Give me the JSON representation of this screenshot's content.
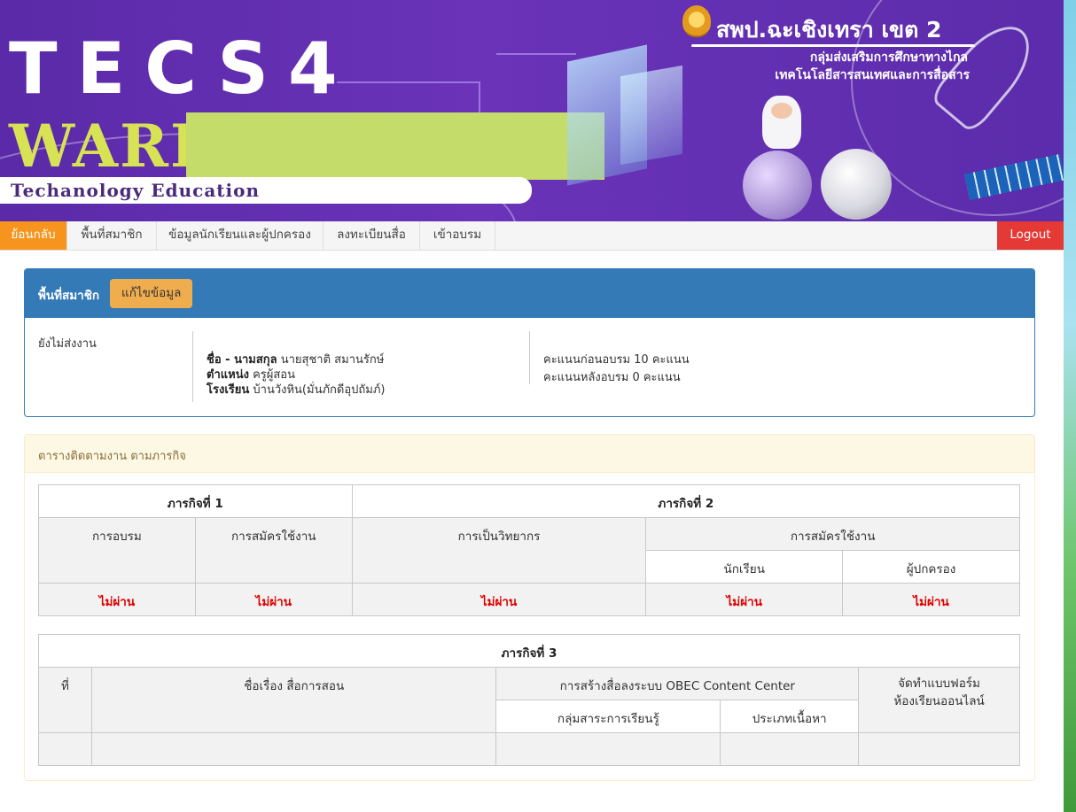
{
  "banner": {
    "logo_line1": "TECS4",
    "logo_line2": "WARR",
    "tagline": "Techanology Education",
    "agency": "สพป.ฉะเชิงเทรา เขต 2",
    "agency_sub1": "กลุ่มส่งเสริมการศึกษาทางไกล",
    "agency_sub2": "เทคโนโลยีสารสนเทศและการสื่อสาร"
  },
  "nav": {
    "back": "ย้อนกลับ",
    "items": [
      "พื้นที่สมาชิก",
      "ข้อมูลนักเรียนและผู้ปกครอง",
      "ลงทะเบียนสื่อ",
      "เข้าอบรม"
    ],
    "logout": "Logout"
  },
  "member": {
    "title": "พื้นที่สมาชิก",
    "edit_button": "แก้ไขข้อมูล",
    "status": "ยังไม่ส่งงาน",
    "name_label": "ชื่อ - นามสกุล",
    "name_value": "นายสุชาติ สมานรักษ์",
    "position_label": "ตำแหน่ง",
    "position_value": "ครูผู้สอน",
    "school_label": "โรงเรียน",
    "school_value": "บ้านวังหิน(มั่นภักดีอุปถัมภ์)",
    "pre_score": "คะแนนก่อนอบรม 10 คะแนน",
    "post_score": "คะแนนหลังอบรม 0 คะแนน"
  },
  "tracking": {
    "title": "ตารางติดตามงาน ตามภารกิจ",
    "mission1": {
      "title": "ภารกิจที่ 1",
      "col_training": "การอบรม",
      "col_signup": "การสมัครใช้งาน",
      "result_training": "ไม่ผ่าน",
      "result_signup": "ไม่ผ่าน"
    },
    "mission2": {
      "title": "ภารกิจที่ 2",
      "col_speaker": "การเป็นวิทยากร",
      "col_signup": "การสมัครใช้งาน",
      "col_students": "นักเรียน",
      "col_parents": "ผู้ปกครอง",
      "result_speaker": "ไม่ผ่าน",
      "result_students": "ไม่ผ่าน",
      "result_parents": "ไม่ผ่าน"
    },
    "mission3": {
      "title": "ภารกิจที่ 3",
      "col_no": "ที่",
      "col_title": "ชื่อเรื่อง สื่อการสอน",
      "col_obec": "การสร้างสื่อลงระบบ OBEC Content Center",
      "col_subject": "กลุ่มสาระการเรียนรู้",
      "col_content_type": "ประเภทเนื้อหา",
      "col_form_line1": "จัดทำแบบฟอร์ม",
      "col_form_line2": "ห้องเรียนออนไลน์"
    }
  }
}
